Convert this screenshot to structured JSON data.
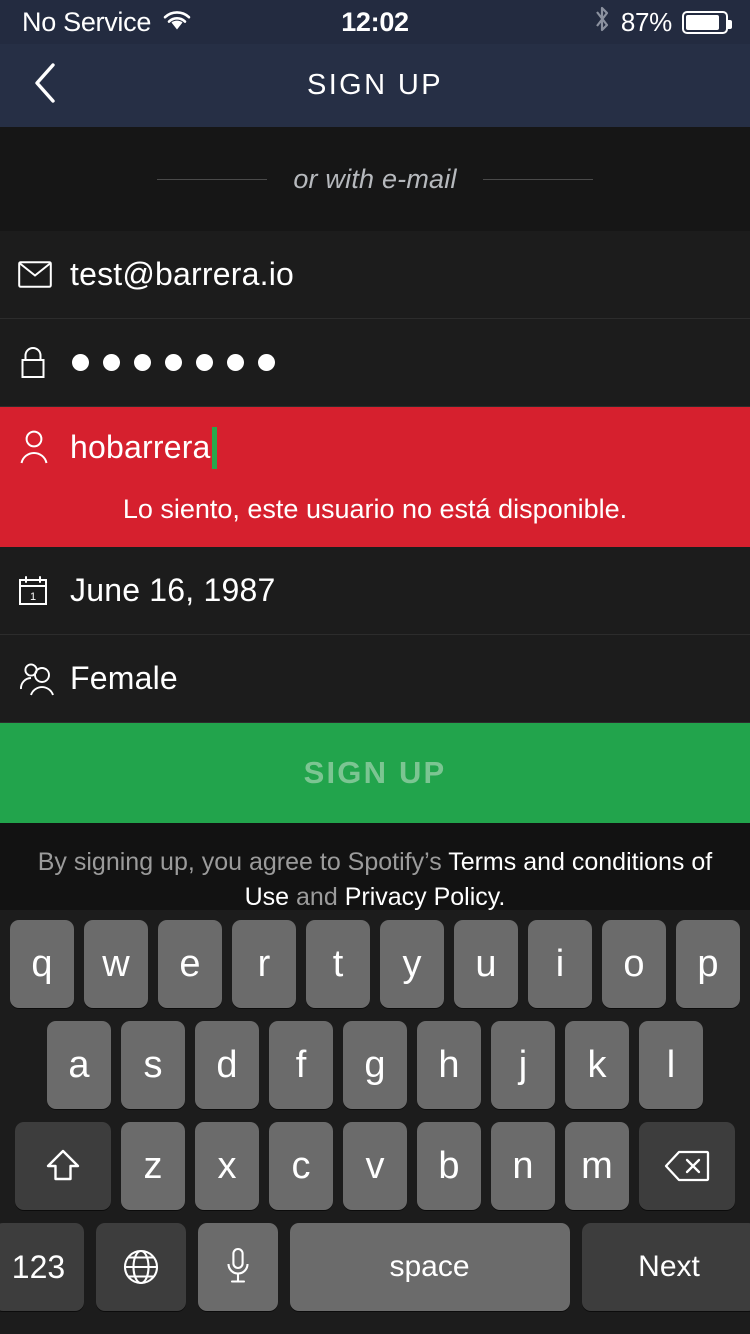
{
  "status_bar": {
    "carrier": "No Service",
    "wifi_icon": "wifi-icon",
    "time": "12:02",
    "bluetooth_icon": "bluetooth-icon",
    "battery_percent": "87%",
    "battery_level": 87
  },
  "nav_bar": {
    "back_icon": "chevron-left-icon",
    "title": "SIGN UP"
  },
  "divider": {
    "text": "or with e-mail"
  },
  "form": {
    "email": {
      "icon": "envelope-icon",
      "value": "test@barrera.io",
      "placeholder": "Email"
    },
    "password": {
      "icon": "lock-icon",
      "value": "● ● ● ● ● ● ●",
      "dots": 7,
      "placeholder": "Password"
    },
    "username": {
      "icon": "person-icon",
      "value": "hobarrera",
      "placeholder": "Username",
      "error": "Lo siento, este usuario no está disponible.",
      "error_bg": "#d6202e",
      "caret_color": "#27a84c"
    },
    "birthdate": {
      "icon": "calendar-icon",
      "value": "June 16, 1987",
      "calendar_day": "1"
    },
    "gender": {
      "icon": "people-icon",
      "value": "Female"
    }
  },
  "signup_button": {
    "label": "SIGN UP",
    "bg": "#22a44c",
    "text_color": "#7cc592"
  },
  "terms": {
    "prefix": "By signing up, you agree to Spotify’s ",
    "link1": "Terms and conditions of Use",
    "middle": " and ",
    "link2": "Privacy Policy."
  },
  "keyboard": {
    "row1": [
      "q",
      "w",
      "e",
      "r",
      "t",
      "y",
      "u",
      "i",
      "o",
      "p"
    ],
    "row2": [
      "a",
      "s",
      "d",
      "f",
      "g",
      "h",
      "j",
      "k",
      "l"
    ],
    "row3": [
      "z",
      "x",
      "c",
      "v",
      "b",
      "n",
      "m"
    ],
    "shift_icon": "shift-icon",
    "backspace_icon": "backspace-icon",
    "numbers_key": "123",
    "globe_icon": "globe-icon",
    "mic_icon": "microphone-icon",
    "space_key": "space",
    "return_key": "Next"
  }
}
